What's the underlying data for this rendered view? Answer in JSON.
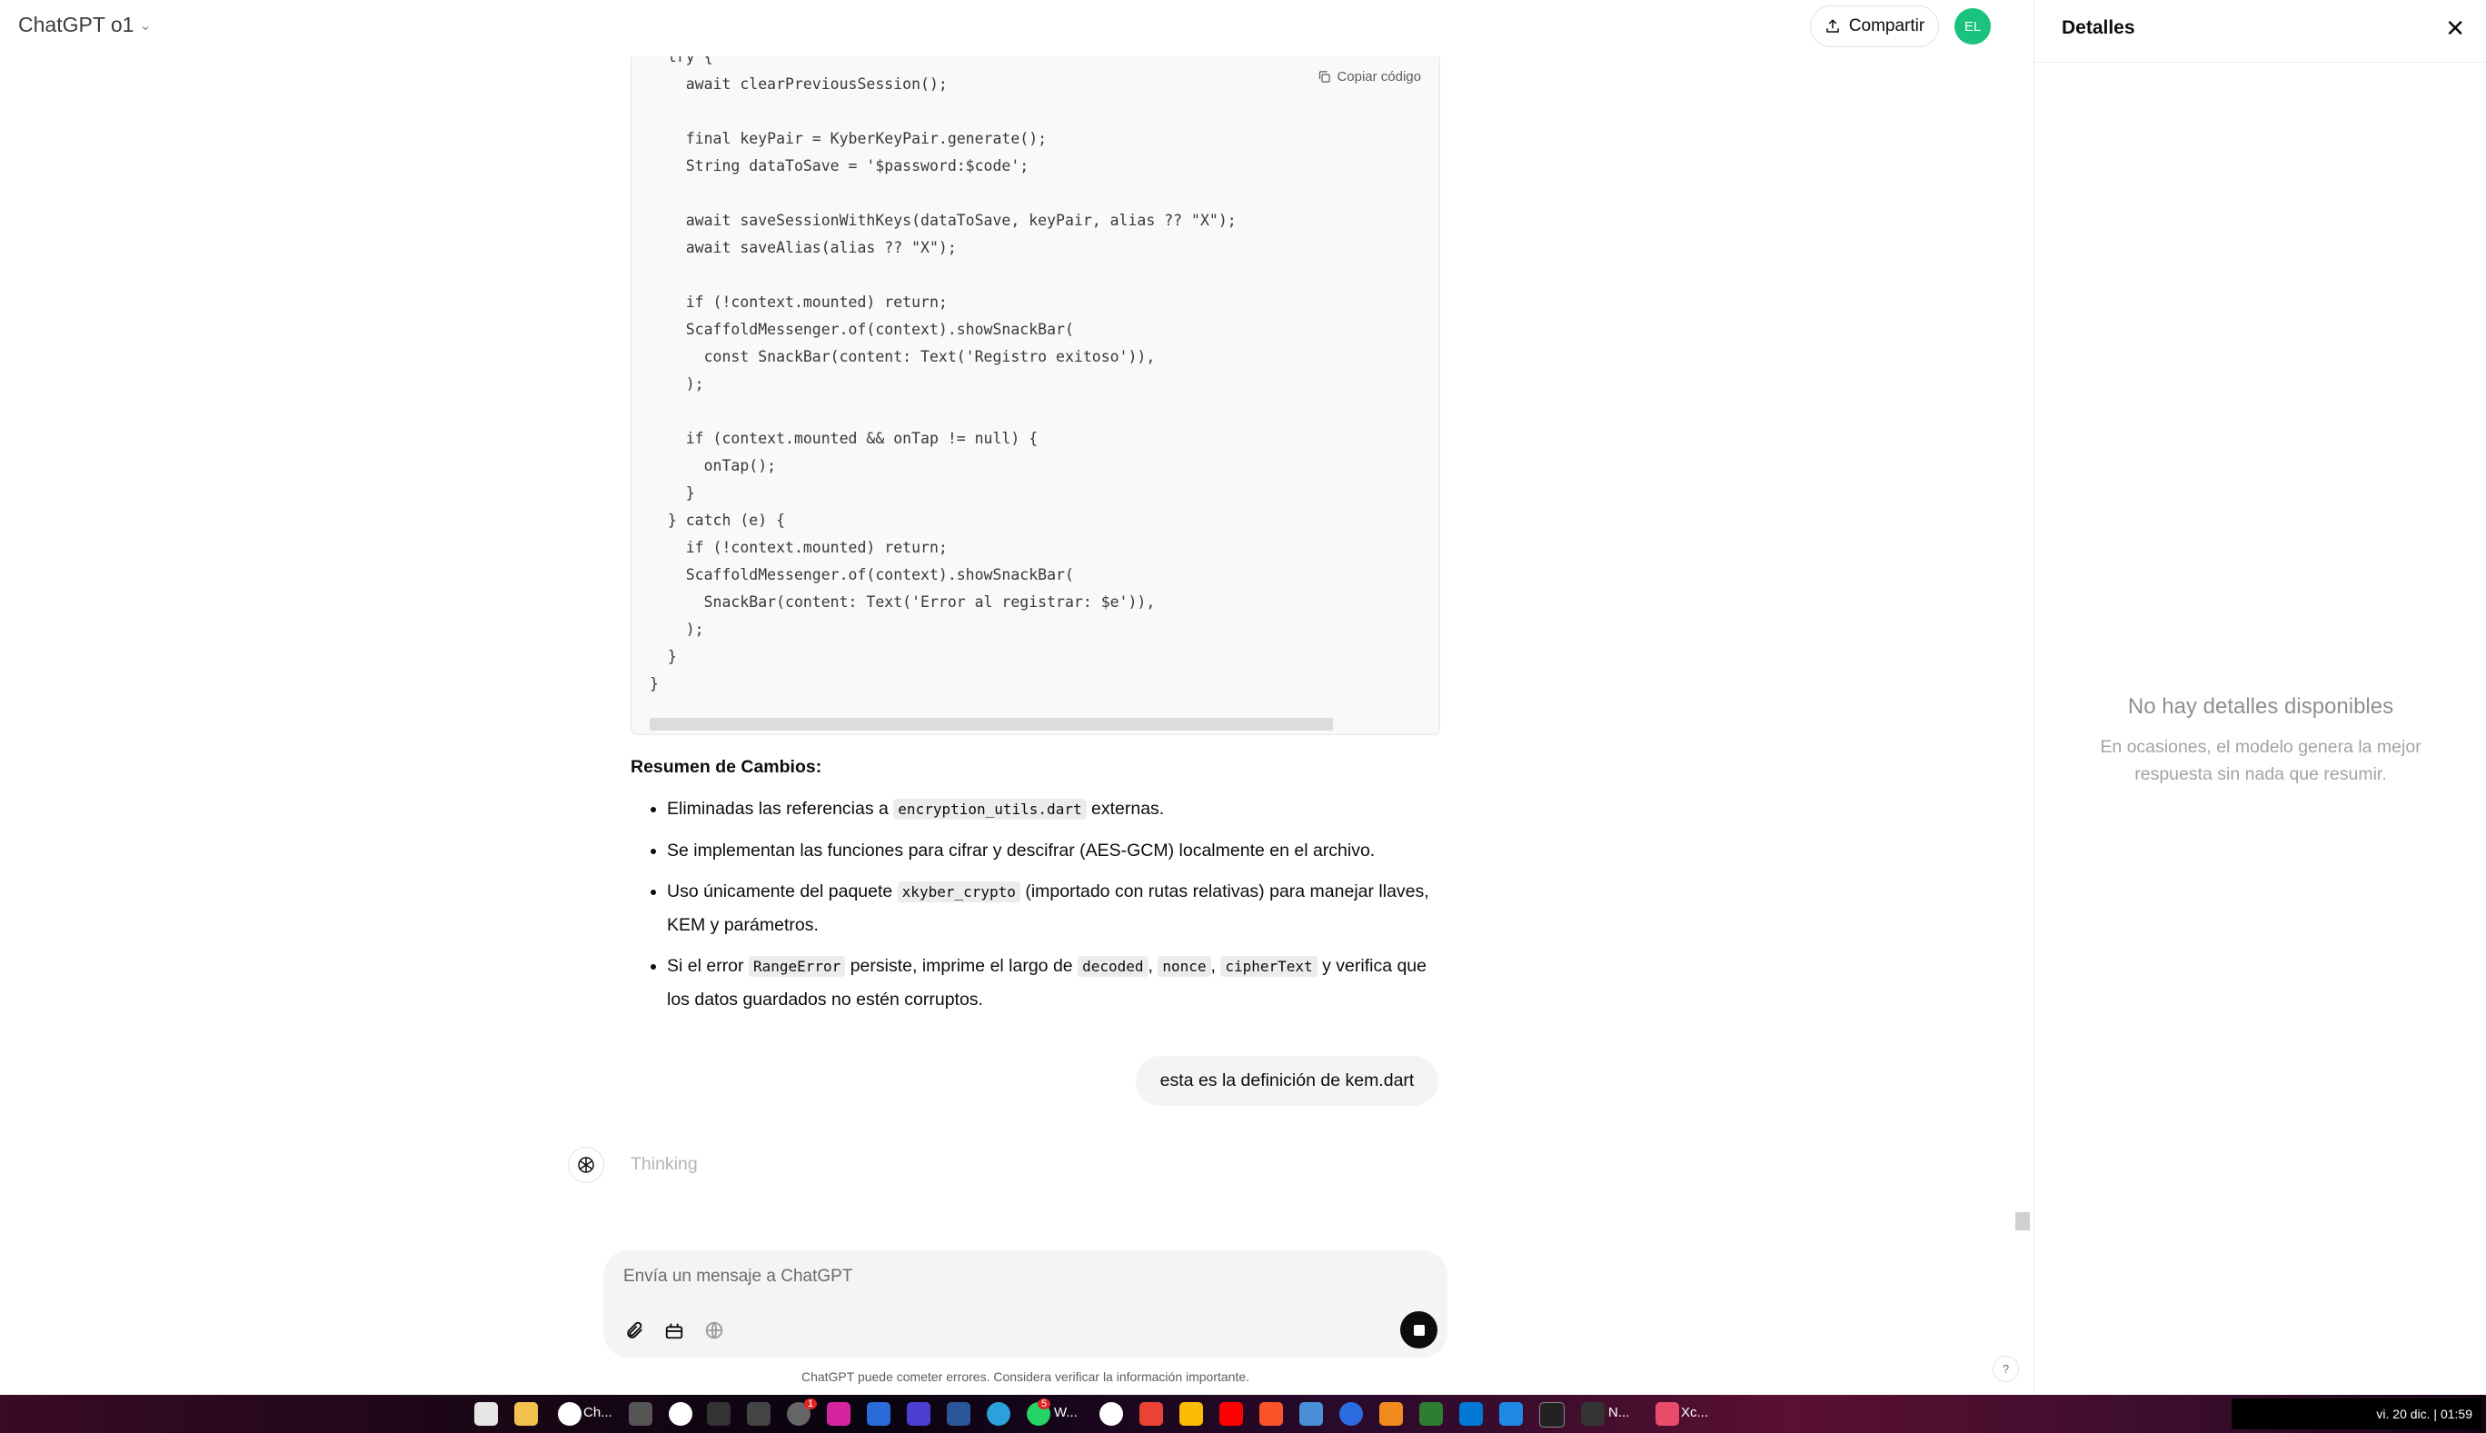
{
  "header": {
    "model_title": "ChatGPT o1",
    "share_label": "Compartir",
    "avatar_initials": "EL"
  },
  "code_block": {
    "copy_label": "Copiar código",
    "code": "  try {\n    await clearPreviousSession();\n\n    final keyPair = KyberKeyPair.generate();\n    String dataToSave = '$password:$code';\n\n    await saveSessionWithKeys(dataToSave, keyPair, alias ?? \"X\");\n    await saveAlias(alias ?? \"X\");\n\n    if (!context.mounted) return;\n    ScaffoldMessenger.of(context).showSnackBar(\n      const SnackBar(content: Text('Registro exitoso')),\n    );\n\n    if (context.mounted && onTap != null) {\n      onTap();\n    }\n  } catch (e) {\n    if (!context.mounted) return;\n    ScaffoldMessenger.of(context).showSnackBar(\n      SnackBar(content: Text('Error al registrar: $e')),\n    );\n  }\n}"
  },
  "summary": {
    "heading": "Resumen de Cambios:",
    "item1": {
      "pre": "Eliminadas las referencias a ",
      "code": "encryption_utils.dart",
      "post": " externas."
    },
    "item2": {
      "text": "Se implementan las funciones para cifrar y descifrar (AES-GCM) localmente en el archivo."
    },
    "item3": {
      "pre": "Uso únicamente del paquete ",
      "code": "xkyber_crypto",
      "post": " (importado con rutas relativas) para manejar llaves, KEM y parámetros."
    },
    "item4": {
      "pre": "Si el error ",
      "code1": "RangeError",
      "mid1": " persiste, imprime el largo de ",
      "code2": "decoded",
      "sep1": ", ",
      "code3": "nonce",
      "sep2": ", ",
      "code4": "cipherText",
      "post": " y verifica que los datos guardados no estén corruptos."
    }
  },
  "user_message": "esta es la definición de kem.dart",
  "assistant_status": "Thinking",
  "composer": {
    "placeholder": "Envía un mensaje a ChatGPT"
  },
  "disclaimer": "ChatGPT puede cometer errores. Considera verificar la información importante.",
  "help_label": "?",
  "side_panel": {
    "title": "Detalles",
    "empty_title": "No hay detalles disponibles",
    "empty_text": "En ocasiones, el modelo genera la mejor respuesta sin nada que resumir."
  },
  "taskbar": {
    "chatgpt_label": "Ch...",
    "whatsapp_label": "W...",
    "notes_label": "N...",
    "xc_label": "Xc...",
    "badge_1": "1",
    "badge_5": "5",
    "clock": "vi. 20 dic. | 01:59"
  },
  "colors": {
    "accent_avatar": "#19c37d",
    "stop_button": "#0d0d0d",
    "code_bg": "#f9f9f9"
  }
}
